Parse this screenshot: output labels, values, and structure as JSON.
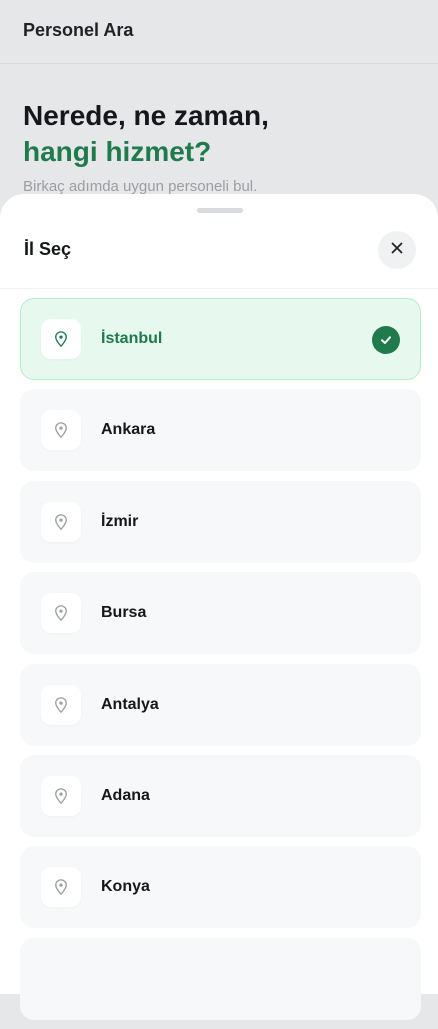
{
  "header": {
    "title": "Personel Ara"
  },
  "hero": {
    "line1": "Nerede, ne zaman,",
    "line2": "hangi hizmet?",
    "subtitle": "Birkaç adımda uygun personeli bul."
  },
  "sheet": {
    "title": "İl Seç",
    "cities": [
      {
        "name": "İstanbul",
        "selected": true
      },
      {
        "name": "Ankara",
        "selected": false
      },
      {
        "name": "İzmir",
        "selected": false
      },
      {
        "name": "Bursa",
        "selected": false
      },
      {
        "name": "Antalya",
        "selected": false
      },
      {
        "name": "Adana",
        "selected": false
      },
      {
        "name": "Konya",
        "selected": false
      },
      {
        "name": "",
        "selected": false
      }
    ]
  },
  "colors": {
    "accent": "#1f7a4c",
    "selected_bg": "#e7f8ee",
    "selected_border": "#b9ebcd",
    "item_bg": "#f7f8f9"
  },
  "icons": {
    "pin": "location-pin-icon",
    "check": "check-icon",
    "close": "close-icon"
  }
}
